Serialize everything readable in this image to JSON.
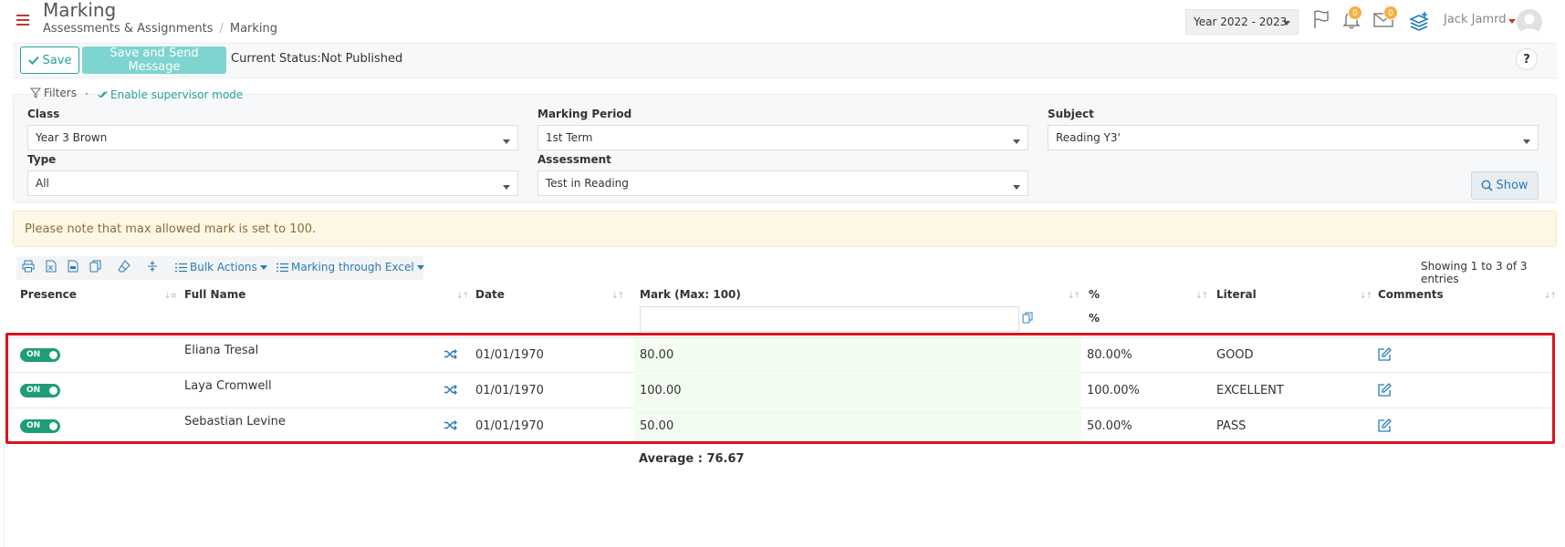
{
  "header": {
    "title": "Marking",
    "breadcrumb": [
      "Assessments & Assignments",
      "Marking"
    ],
    "year": "Year 2022 - 2023",
    "notifications_count": "0",
    "messages_count": "0",
    "user_name": "Jack Jamrd"
  },
  "toolbar": {
    "save_label": "Save",
    "save_send_label": "Save and Send Message",
    "status": "Current Status:Not Published",
    "help_label": "?"
  },
  "filters": {
    "label": "Filters",
    "supervisor_label": "Enable supervisor mode",
    "class_label": "Class",
    "class_value": "Year 3 Brown",
    "period_label": "Marking Period",
    "period_value": "1st Term",
    "subject_label": "Subject",
    "subject_value": "Reading Y3'",
    "type_label": "Type",
    "type_value": "All",
    "assessment_label": "Assessment",
    "assessment_value": "Test in Reading",
    "show_label": "Show"
  },
  "notice": "Please note that max allowed mark is set to 100.",
  "table_tools": {
    "bulk_actions": "Bulk Actions",
    "excel_marking": "Marking through Excel",
    "entries": "Showing 1 to 3 of 3 entries"
  },
  "table": {
    "columns": [
      "Presence",
      "Full Name",
      "Date",
      "Mark (Max: 100)",
      "%",
      "Literal",
      "Comments"
    ],
    "pct_subheader": "%",
    "toggle_label": "ON",
    "rows": [
      {
        "name": "Eliana Tresal",
        "date": "01/01/1970",
        "mark": "80.00",
        "pct": "80.00%",
        "literal": "GOOD"
      },
      {
        "name": "Laya Cromwell",
        "date": "01/01/1970",
        "mark": "100.00",
        "pct": "100.00%",
        "literal": "EXCELLENT"
      },
      {
        "name": "Sebastian Levine",
        "date": "01/01/1970",
        "mark": "50.00",
        "pct": "50.00%",
        "literal": "PASS"
      }
    ],
    "average": "Average : 76.67"
  },
  "colors": {
    "accent": "#27a29a",
    "link": "#2a7bb8",
    "toggle_on": "#1e9d78",
    "highlight": "#d9141b",
    "notice_bg": "#fdf8e5"
  },
  "icons": [
    "hamburger-icon",
    "flag-icon",
    "bell-icon",
    "envelope-icon",
    "layers-icon",
    "check-icon",
    "funnel-icon",
    "search-icon",
    "print-icon",
    "excel-icon",
    "pdf-icon",
    "copy-icon",
    "eraser-icon",
    "compress-icon",
    "list-icon",
    "shuffle-icon",
    "edit-icon"
  ]
}
